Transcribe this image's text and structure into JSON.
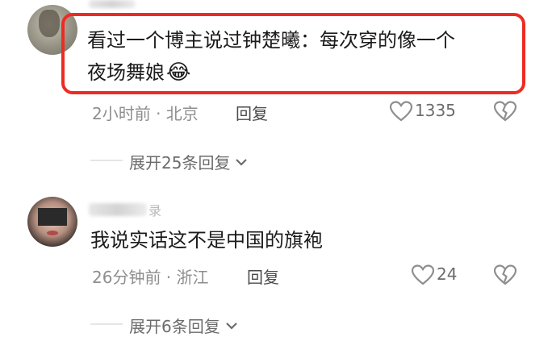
{
  "comments": [
    {
      "text_line1": "看过一个博主说过钟楚曦：每次穿的像一个",
      "text_line2": "夜场舞娘",
      "emoji": "😂",
      "time_location": "2小时前 · 北京",
      "reply_label": "回复",
      "likes": "1335",
      "expand_label": "展开25条回复"
    },
    {
      "username_partial": "录",
      "text": "我说实话这不是中国的旗袍",
      "time_location": "26分钟前 · 浙江",
      "reply_label": "回复",
      "likes": "24",
      "expand_label": "展开6条回复"
    }
  ],
  "colors": {
    "highlight_border": "#ee2b22",
    "text": "#1b1b1b",
    "meta": "#8e8e8e"
  },
  "icons": [
    "heart-outline-icon",
    "broken-heart-outline-icon",
    "chevron-down-icon"
  ]
}
